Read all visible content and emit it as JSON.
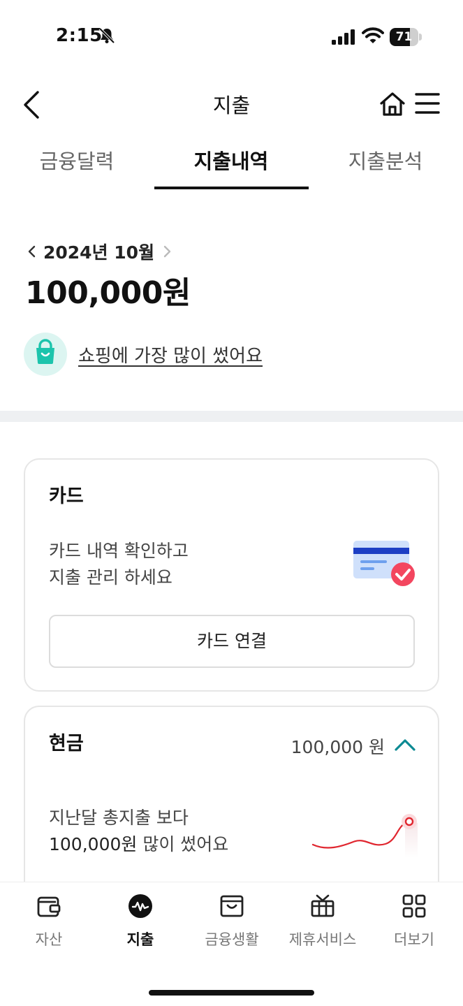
{
  "status": {
    "time": "2:15",
    "battery": "71",
    "battery_level": 0.71
  },
  "header": {
    "title": "지출"
  },
  "tabs": [
    {
      "label": "금융달력",
      "active": false
    },
    {
      "label": "지출내역",
      "active": true
    },
    {
      "label": "지출분석",
      "active": false
    }
  ],
  "summary": {
    "month": "2024년 10월",
    "total": "100,000원",
    "insight": "쇼핑에 가장 많이 썼어요"
  },
  "card_section": {
    "title": "카드",
    "desc_line1": "카드 내역 확인하고",
    "desc_line2": "지출 관리 하세요",
    "connect_label": "카드 연결"
  },
  "cash_section": {
    "title": "현금",
    "amount": "100,000 원",
    "desc_line1": "지난달 총지출 보다",
    "desc_amount": "100,000원",
    "desc_suffix": " 많이 썼어요"
  },
  "bottom_nav": [
    {
      "label": "자산",
      "icon": "wallet-icon",
      "active": false
    },
    {
      "label": "지출",
      "icon": "spending-icon",
      "active": true
    },
    {
      "label": "금융생활",
      "icon": "shopping-bag-icon",
      "active": false
    },
    {
      "label": "제휴서비스",
      "icon": "gift-icon",
      "active": false
    },
    {
      "label": "더보기",
      "icon": "grid-icon",
      "active": false
    }
  ],
  "colors": {
    "accent_mint": "#1cc4ac",
    "badge_bg": "#dcf5f1",
    "trend_red": "#e0262f",
    "toggle_teal": "#0c8a93"
  }
}
